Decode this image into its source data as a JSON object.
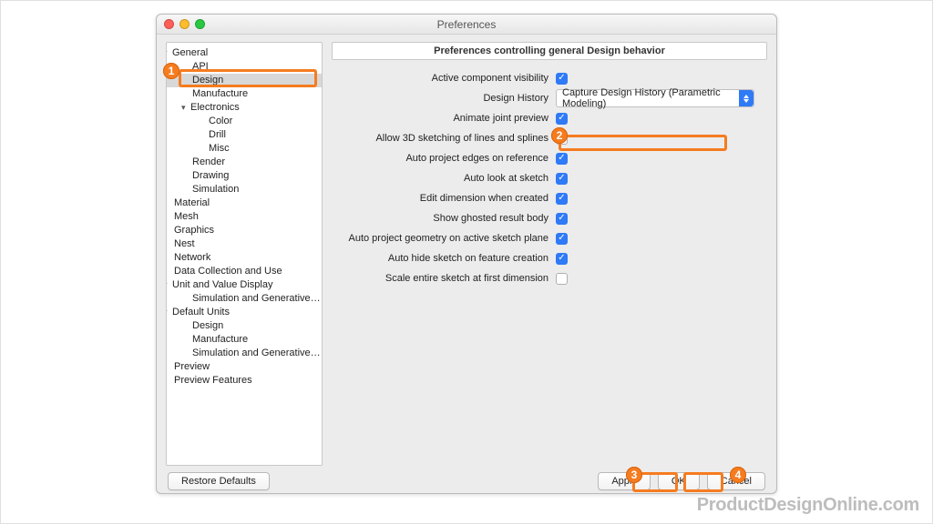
{
  "window": {
    "title": "Preferences"
  },
  "sidebar": {
    "items": [
      {
        "label": "General",
        "level": 0,
        "disclosure": true,
        "open": true
      },
      {
        "label": "API",
        "level": 1
      },
      {
        "label": "Design",
        "level": 1,
        "selected": true
      },
      {
        "label": "Manufacture",
        "level": 1
      },
      {
        "label": "Electronics",
        "level": 1,
        "disclosure": true,
        "open": true
      },
      {
        "label": "Color",
        "level": 2
      },
      {
        "label": "Drill",
        "level": 2
      },
      {
        "label": "Misc",
        "level": 2
      },
      {
        "label": "Render",
        "level": 1
      },
      {
        "label": "Drawing",
        "level": 1
      },
      {
        "label": "Simulation",
        "level": 1
      },
      {
        "label": "Material",
        "level": 0
      },
      {
        "label": "Mesh",
        "level": 0
      },
      {
        "label": "Graphics",
        "level": 0
      },
      {
        "label": "Nest",
        "level": 0
      },
      {
        "label": "Network",
        "level": 0
      },
      {
        "label": "Data Collection and Use",
        "level": 0
      },
      {
        "label": "Unit and Value Display",
        "level": 0,
        "disclosure": true,
        "open": true
      },
      {
        "label": "Simulation and Generative Desi…",
        "level": 1
      },
      {
        "label": "Default Units",
        "level": 0,
        "disclosure": true,
        "open": true
      },
      {
        "label": "Design",
        "level": 1
      },
      {
        "label": "Manufacture",
        "level": 1
      },
      {
        "label": "Simulation and Generative Desi…",
        "level": 1
      },
      {
        "label": "Preview",
        "level": 0
      },
      {
        "label": "Preview Features",
        "level": 0
      }
    ]
  },
  "main": {
    "header": "Preferences controlling general Design behavior",
    "rows": [
      {
        "label": "Active component visibility",
        "type": "checkbox",
        "checked": true
      },
      {
        "label": "Design History",
        "type": "select",
        "value": "Capture Design History (Parametric Modeling)"
      },
      {
        "label": "Animate joint preview",
        "type": "checkbox",
        "checked": true
      },
      {
        "label": "Allow 3D sketching of lines and splines",
        "type": "checkbox",
        "checked": false
      },
      {
        "label": "Auto project edges on reference",
        "type": "checkbox",
        "checked": true,
        "highlight": true
      },
      {
        "label": "Auto look at sketch",
        "type": "checkbox",
        "checked": true
      },
      {
        "label": "Edit dimension when created",
        "type": "checkbox",
        "checked": true
      },
      {
        "label": "Show ghosted result body",
        "type": "checkbox",
        "checked": true
      },
      {
        "label": "Auto project geometry on active sketch plane",
        "type": "checkbox",
        "checked": true
      },
      {
        "label": "Auto hide sketch on feature creation",
        "type": "checkbox",
        "checked": true
      },
      {
        "label": "Scale entire sketch at first dimension",
        "type": "checkbox",
        "checked": false
      }
    ]
  },
  "buttons": {
    "restore": "Restore Defaults",
    "apply": "Apply",
    "ok": "OK",
    "cancel": "Cancel"
  },
  "callouts": {
    "c1": "1",
    "c2": "2",
    "c3": "3",
    "c4": "4"
  },
  "watermark": "ProductDesignOnline.com"
}
